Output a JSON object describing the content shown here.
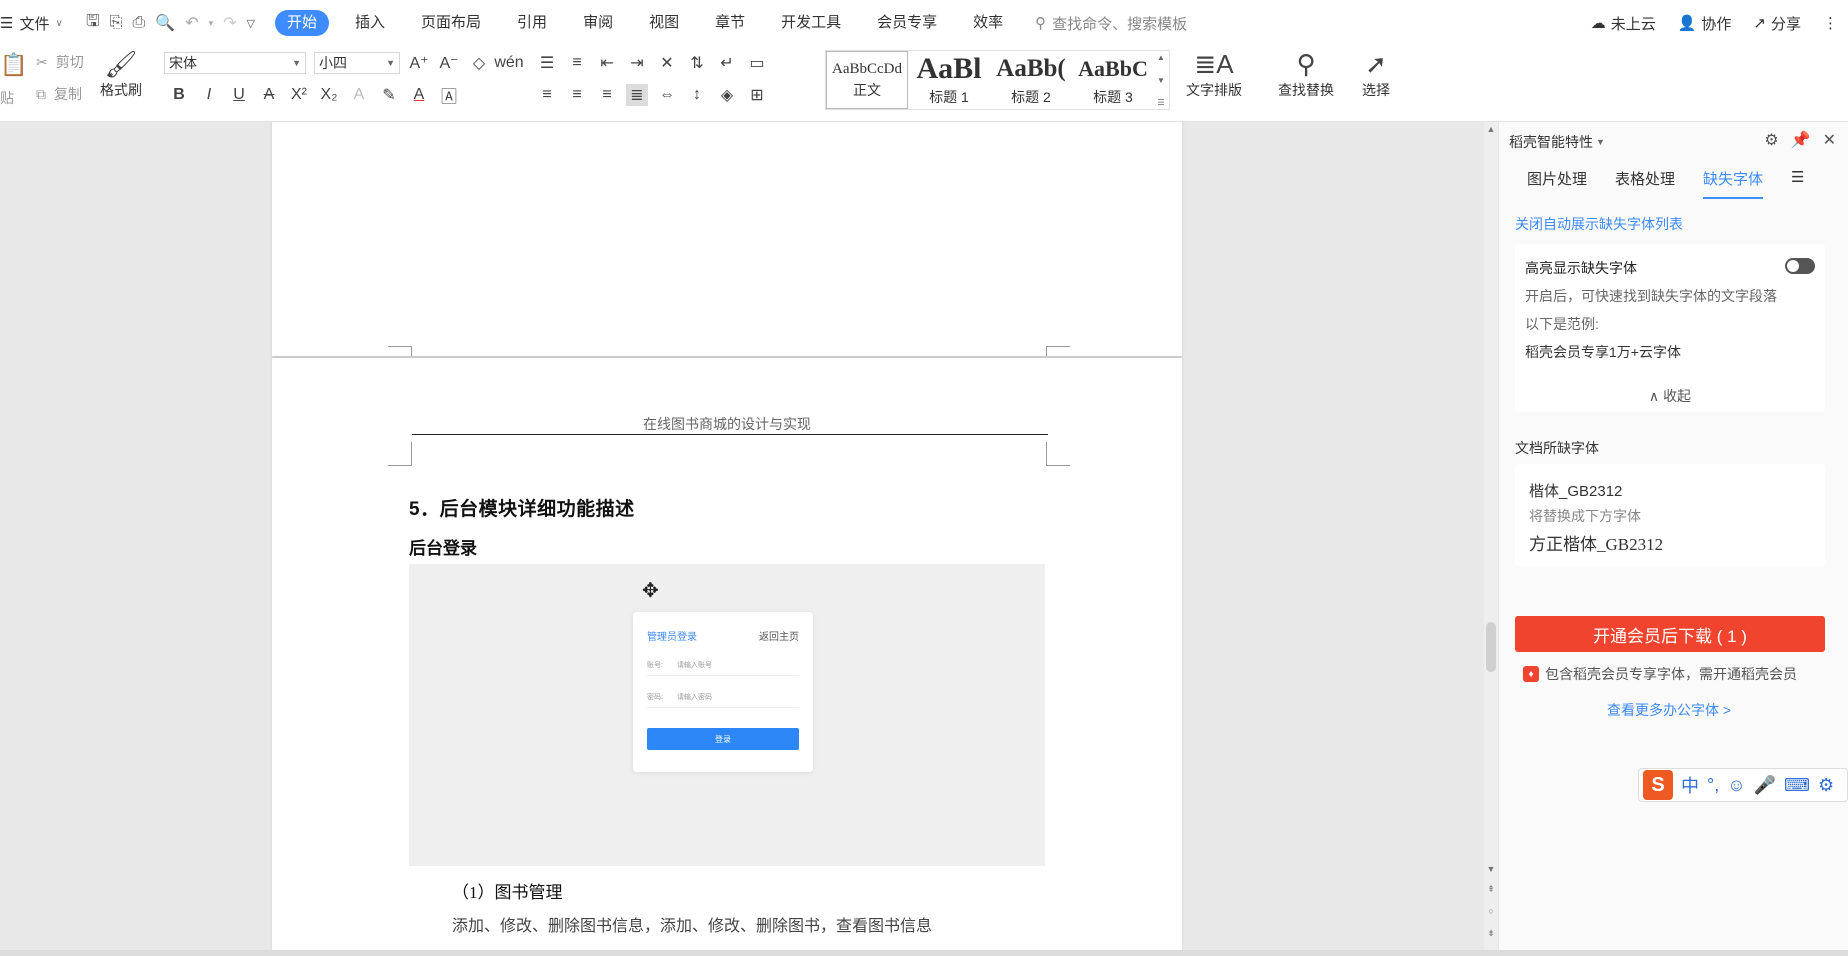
{
  "menubar": {
    "file_label": "文件",
    "tabs": [
      {
        "label": "开始"
      },
      {
        "label": "插入"
      },
      {
        "label": "页面布局"
      },
      {
        "label": "引用"
      },
      {
        "label": "审阅"
      },
      {
        "label": "视图"
      },
      {
        "label": "章节"
      },
      {
        "label": "开发工具"
      },
      {
        "label": "会员专享"
      },
      {
        "label": "效率"
      }
    ],
    "search_placeholder": "查找命令、搜索模板",
    "cloud_label": "未上云",
    "collab_label": "协作",
    "share_label": "分享"
  },
  "ribbon": {
    "paste_label": "贴",
    "cut_label": "剪切",
    "copy_label": "复制",
    "format_painter_label": "格式刷",
    "font_name": "宋体",
    "font_size": "小四",
    "styles": [
      {
        "sample": "AaBbCcDd",
        "label": "正文"
      },
      {
        "sample": "AaBl",
        "label": "标题 1"
      },
      {
        "sample": "AaBb(",
        "label": "标题 2"
      },
      {
        "sample": "AaBbC",
        "label": "标题 3"
      }
    ],
    "text_layout_label": "文字排版",
    "find_replace_label": "查找替换",
    "select_label": "选择"
  },
  "document": {
    "running_head": "在线图书商城的设计与实现",
    "heading": "5．后台模块详细功能描述",
    "subheading": "后台登录",
    "login_card": {
      "title": "管理员登录",
      "back": "返回主页",
      "account_label": "账号:",
      "account_placeholder": "请输入账号",
      "password_label": "密码:",
      "password_placeholder": "请输入密码",
      "button": "登录"
    },
    "list_item_1": "（1）图书管理",
    "list_item_2": "添加、修改、删除图书信息，添加、修改、删除图书，查看图书信息"
  },
  "panel": {
    "title": "稻壳智能特性",
    "tabs": [
      {
        "label": "图片处理"
      },
      {
        "label": "表格处理"
      },
      {
        "label": "缺失字体"
      }
    ],
    "close_auto_link": "关闭自动展示缺失字体列表",
    "highlight_label": "高亮显示缺失字体",
    "highlight_desc": "开启后，可快速找到缺失字体的文字段落",
    "example_label": "以下是范例:",
    "example_text": "稻壳会员专享1万+云字体",
    "collapse_label": "收起",
    "missing_title": "文档所缺字体",
    "missing_font": "楷体_GB2312",
    "replace_hint": "将替换成下方字体",
    "replacement_font": "方正楷体_GB2312",
    "cta": "开通会员后下载 ( 1 )",
    "notice": "包含稻壳会员专享字体，需开通稻壳会员",
    "more_link": "查看更多办公字体 >"
  },
  "ime": {
    "logo": "S",
    "mode": "中"
  },
  "colors": {
    "accent": "#3d8bfd",
    "cta_red": "#f0442f"
  }
}
